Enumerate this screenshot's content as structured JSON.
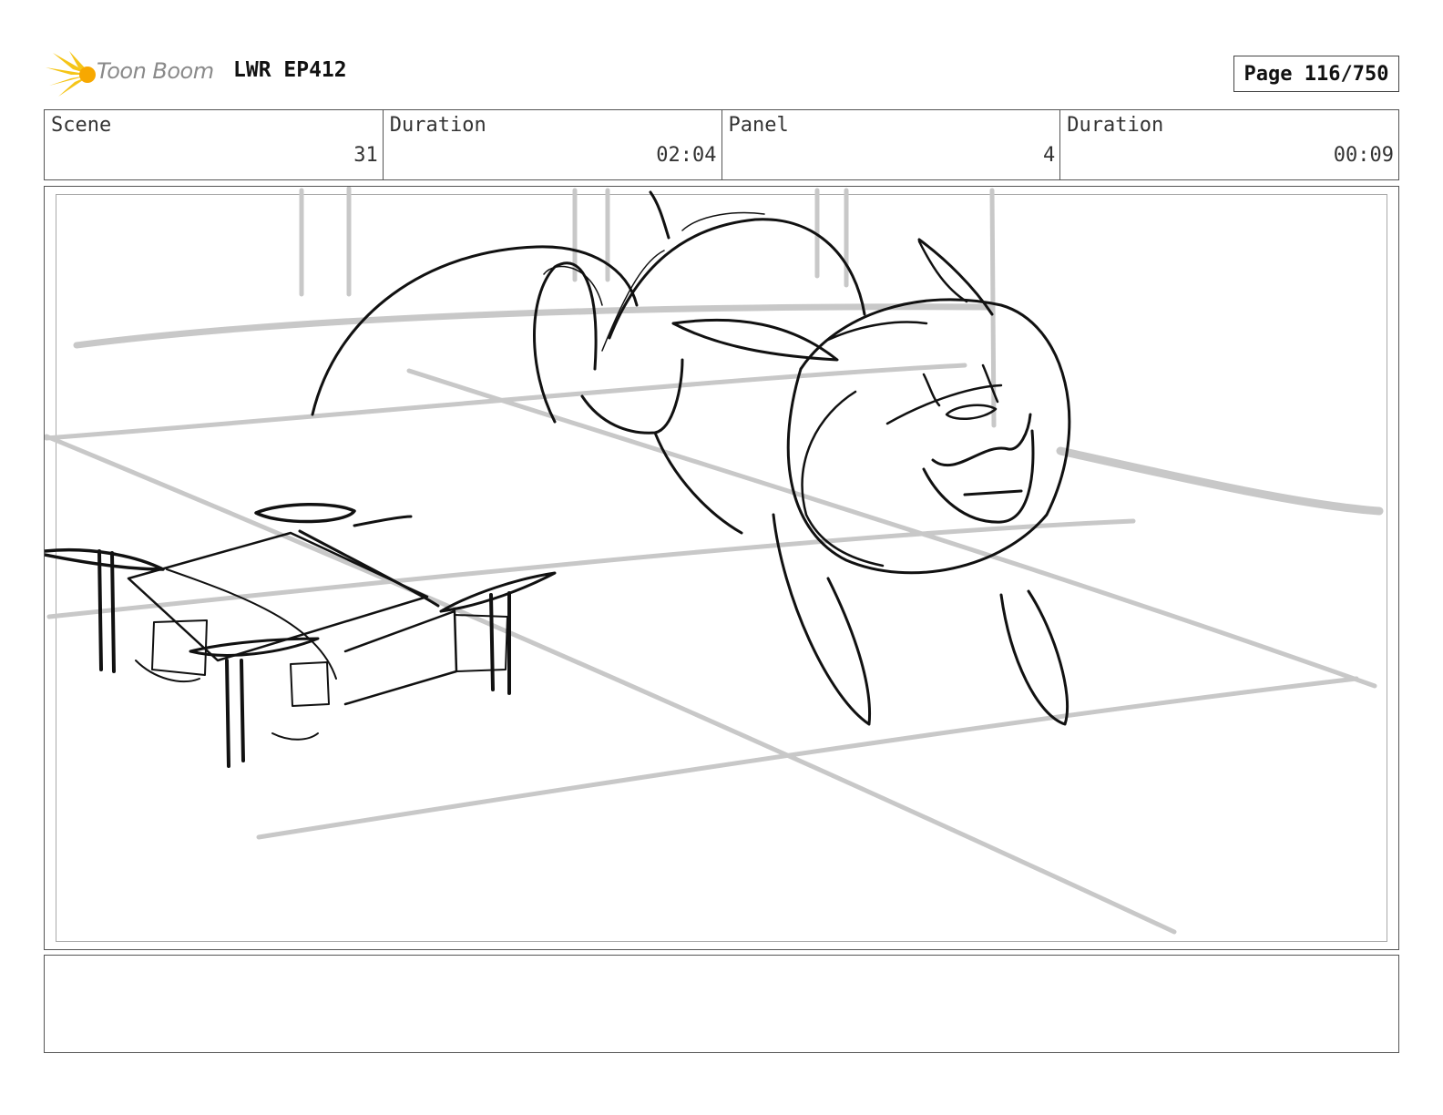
{
  "header": {
    "brand": "Toon Boom",
    "episode": "LWR EP412",
    "page_label": "Page 116/750"
  },
  "info": {
    "scene_label": "Scene",
    "scene_value": "31",
    "scene_duration_label": "Duration",
    "scene_duration_value": "02:04",
    "panel_label": "Panel",
    "panel_value": "4",
    "panel_duration_label": "Duration",
    "panel_duration_value": "00:09"
  },
  "colors": {
    "logo_yellow": "#f5c518",
    "logo_text": "#8a8a8a",
    "sketch_line": "#111111",
    "guide_line": "#c8c8c8"
  },
  "notes": {
    "text": ""
  }
}
